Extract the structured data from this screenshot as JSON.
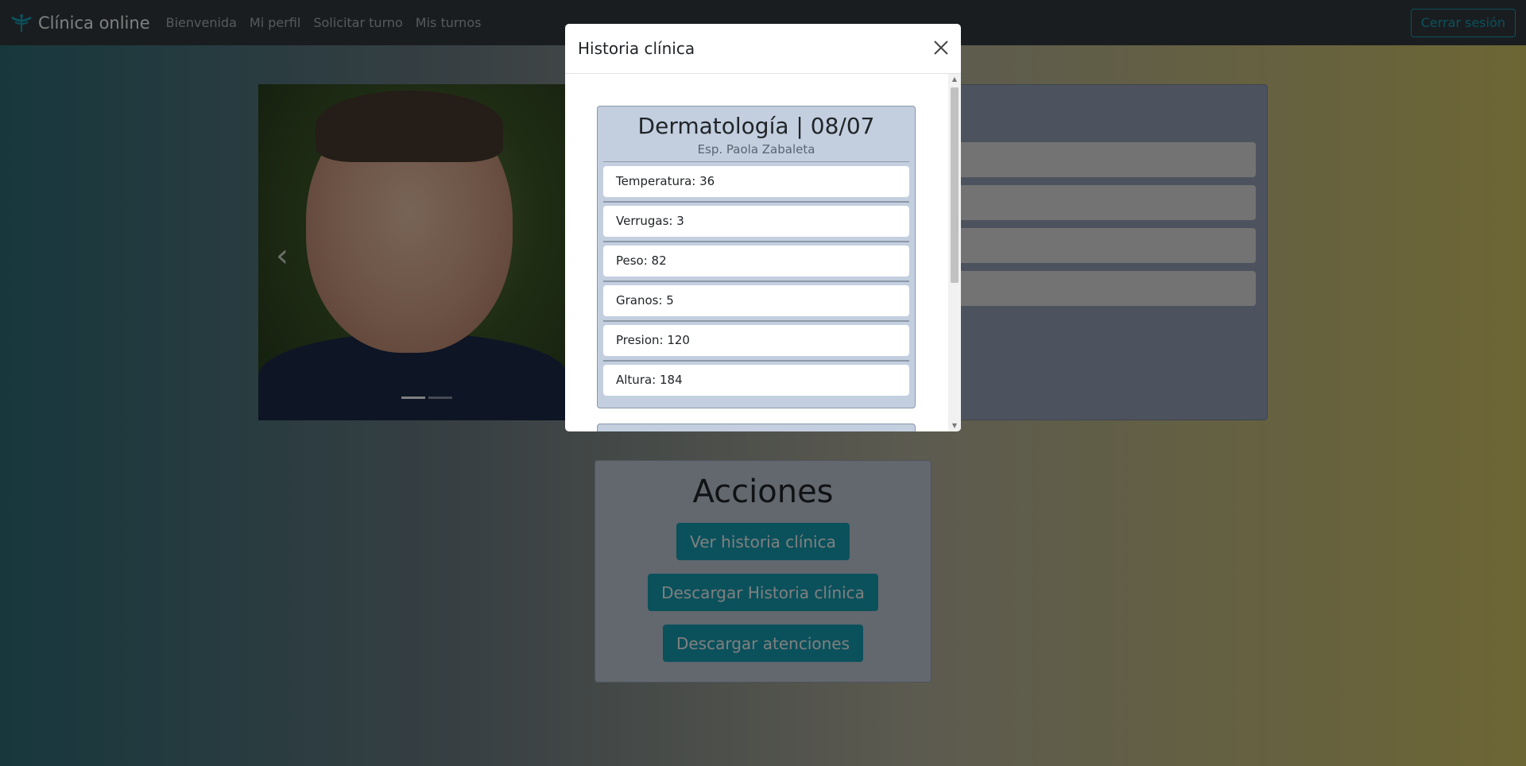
{
  "navbar": {
    "brand": "Clínica online",
    "links": [
      "Bienvenida",
      "Mi perfil",
      "Solicitar turno",
      "Mis turnos"
    ],
    "logout": "Cerrar sesión",
    "logout_color": "#17a2b8"
  },
  "actions": {
    "title": "Acciones",
    "buttons": [
      "Ver historia clínica",
      "Descargar Historia clínica",
      "Descargar atenciones"
    ]
  },
  "modal": {
    "title": "Historia clínica",
    "record": {
      "title": "Dermatología | 08/07",
      "subtitle": "Esp. Paola Zabaleta",
      "items": [
        "Temperatura: 36",
        "Verrugas: 3",
        "Peso: 82",
        "Granos: 5",
        "Presion: 120",
        "Altura: 184"
      ]
    }
  },
  "icons": {
    "close": "close-icon",
    "carousel_prev": "chevron-left-icon",
    "brand": "caduceus-logo"
  }
}
